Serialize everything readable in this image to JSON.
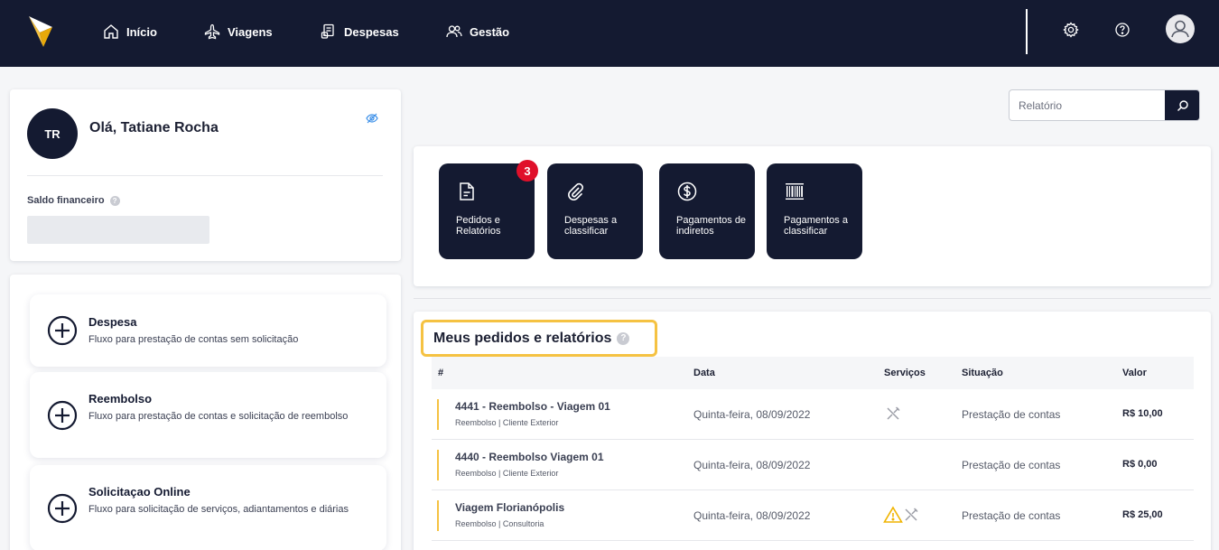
{
  "nav": {
    "items": [
      {
        "label": "Início",
        "icon": "home-icon"
      },
      {
        "label": "Viagens",
        "icon": "plane-icon"
      },
      {
        "label": "Despesas",
        "icon": "receipt-icon"
      },
      {
        "label": "Gestão",
        "icon": "users-icon"
      }
    ],
    "right_icons": [
      "gear-icon",
      "help-icon",
      "user-avatar-icon"
    ]
  },
  "profile": {
    "initials": "TR",
    "greeting": "Olá, Tatiane Rocha",
    "balance_label": "Saldo financeiro"
  },
  "actions": [
    {
      "title": "Despesa",
      "description": "Fluxo para prestação de contas sem solicitação"
    },
    {
      "title": "Reembolso",
      "description": "Fluxo para prestação de contas e solicitação de reembolso"
    },
    {
      "title": "Solicitaçao Online",
      "description": "Fluxo para solicitação de serviços, adiantamentos e diárias"
    }
  ],
  "search": {
    "placeholder": "Relatório"
  },
  "tiles": [
    {
      "label": "Pedidos e Relatórios",
      "icon": "document-icon",
      "badge": "3"
    },
    {
      "label": "Despesas a classificar",
      "icon": "paperclip-icon"
    },
    {
      "label": "Pagamentos de indiretos",
      "icon": "dollar-icon"
    },
    {
      "label": "Pagamentos a classificar",
      "icon": "barcode-icon"
    }
  ],
  "requests": {
    "title": "Meus pedidos e relatórios",
    "columns": [
      "#",
      "Data",
      "Serviços",
      "Situação",
      "Valor"
    ],
    "rows": [
      {
        "title": "4441 - Reembolso - Viagem 01",
        "subtitle": "Reembolso | Cliente Exterior",
        "date": "Quinta-feira, 08/09/2022",
        "services": [
          "cutlery-icon"
        ],
        "status": "Prestação de contas",
        "value": "R$ 10,00"
      },
      {
        "title": "4440 - Reembolso Viagem 01",
        "subtitle": "Reembolso | Cliente Exterior",
        "date": "Quinta-feira, 08/09/2022",
        "services": [],
        "status": "Prestação de contas",
        "value": "R$ 0,00"
      },
      {
        "title": "Viagem Florianópolis",
        "subtitle": "Reembolso | Consultoria",
        "date": "Quinta-feira, 08/09/2022",
        "services": [
          "warning-icon",
          "cutlery-icon"
        ],
        "status": "Prestação de contas",
        "value": "R$ 25,00"
      }
    ]
  },
  "colors": {
    "navy": "#141a31",
    "accent": "#f5c242",
    "badge": "#e0102a"
  }
}
